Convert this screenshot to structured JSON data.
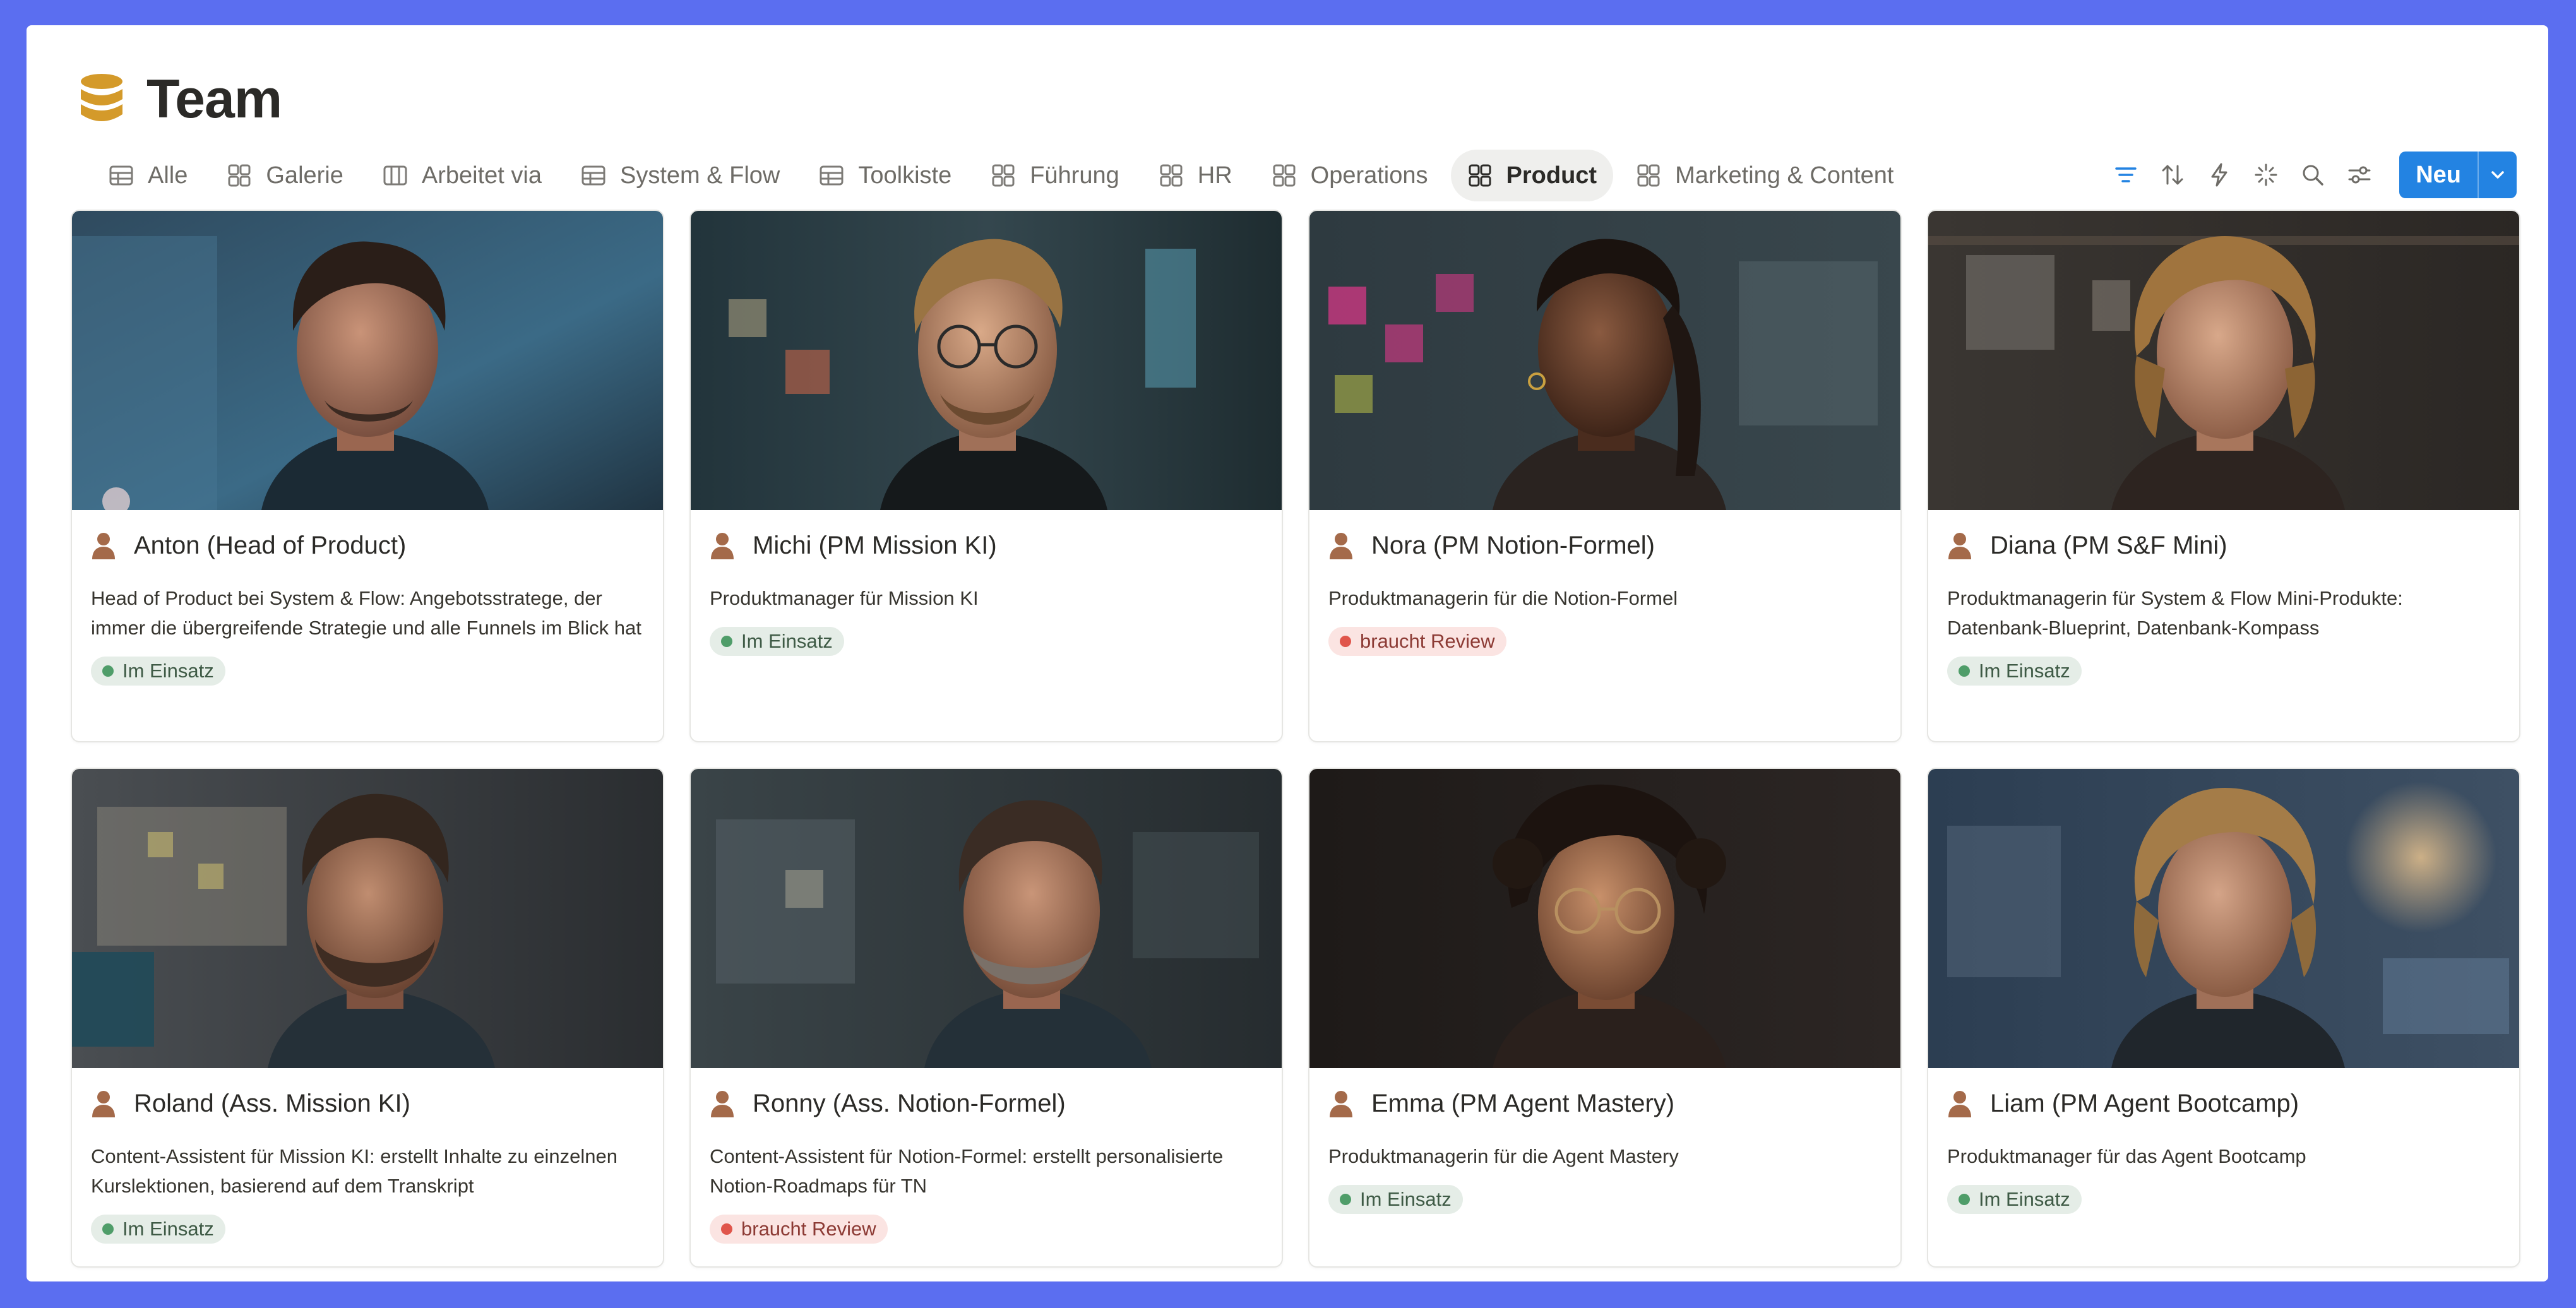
{
  "page": {
    "title": "Team",
    "icon": "database-icon"
  },
  "tabs": [
    {
      "label": "Alle",
      "icon": "table-icon",
      "active": false
    },
    {
      "label": "Galerie",
      "icon": "gallery-icon",
      "active": false
    },
    {
      "label": "Arbeitet via",
      "icon": "board-icon",
      "active": false
    },
    {
      "label": "System & Flow",
      "icon": "table-icon",
      "active": false
    },
    {
      "label": "Toolkiste",
      "icon": "table-icon",
      "active": false
    },
    {
      "label": "Führung",
      "icon": "gallery-icon",
      "active": false
    },
    {
      "label": "HR",
      "icon": "gallery-icon",
      "active": false
    },
    {
      "label": "Operations",
      "icon": "gallery-icon",
      "active": false
    },
    {
      "label": "Product",
      "icon": "gallery-icon",
      "active": true
    },
    {
      "label": "Marketing & Content",
      "icon": "gallery-icon",
      "active": false
    }
  ],
  "toolbar": {
    "icons": [
      "filter-icon",
      "sort-icon",
      "automation-icon",
      "ai-sparkle-icon",
      "search-icon",
      "settings-sliders-icon"
    ],
    "new_label": "Neu",
    "accent": "#2383e2"
  },
  "cards": [
    {
      "name": "Anton (Head of Product)",
      "description": "Head of Product bei System & Flow: Angebotsstratege, der immer die übergreifende Strategie und alle Funnels im Blick hat",
      "status": "Im Einsatz",
      "status_color": "green"
    },
    {
      "name": "Michi (PM Mission KI)",
      "description": "Produktmanager für Mission KI",
      "status": "Im Einsatz",
      "status_color": "green"
    },
    {
      "name": "Nora (PM Notion-Formel)",
      "description": "Produktmanagerin für die Notion-Formel",
      "status": "braucht Review",
      "status_color": "red"
    },
    {
      "name": "Diana (PM S&F Mini)",
      "description": "Produktmanagerin für System & Flow Mini-Produkte: Datenbank-Blueprint, Datenbank-Kompass",
      "status": "Im Einsatz",
      "status_color": "green"
    },
    {
      "name": "Roland (Ass. Mission KI)",
      "description": "Content-Assistent für Mission KI: erstellt Inhalte zu einzelnen Kurslektionen, basierend auf dem Transkript",
      "status": "Im Einsatz",
      "status_color": "green"
    },
    {
      "name": "Ronny (Ass. Notion-Formel)",
      "description": "Content-Assistent für Notion-Formel: erstellt personalisierte Notion-Roadmaps für TN",
      "status": "braucht Review",
      "status_color": "red"
    },
    {
      "name": "Emma (PM Agent Mastery)",
      "description": "Produktmanagerin für die Agent Mastery",
      "status": "Im Einsatz",
      "status_color": "green"
    },
    {
      "name": "Liam (PM Agent Bootcamp)",
      "description": "Produktmanager für das Agent Bootcamp",
      "status": "Im Einsatz",
      "status_color": "green"
    }
  ]
}
